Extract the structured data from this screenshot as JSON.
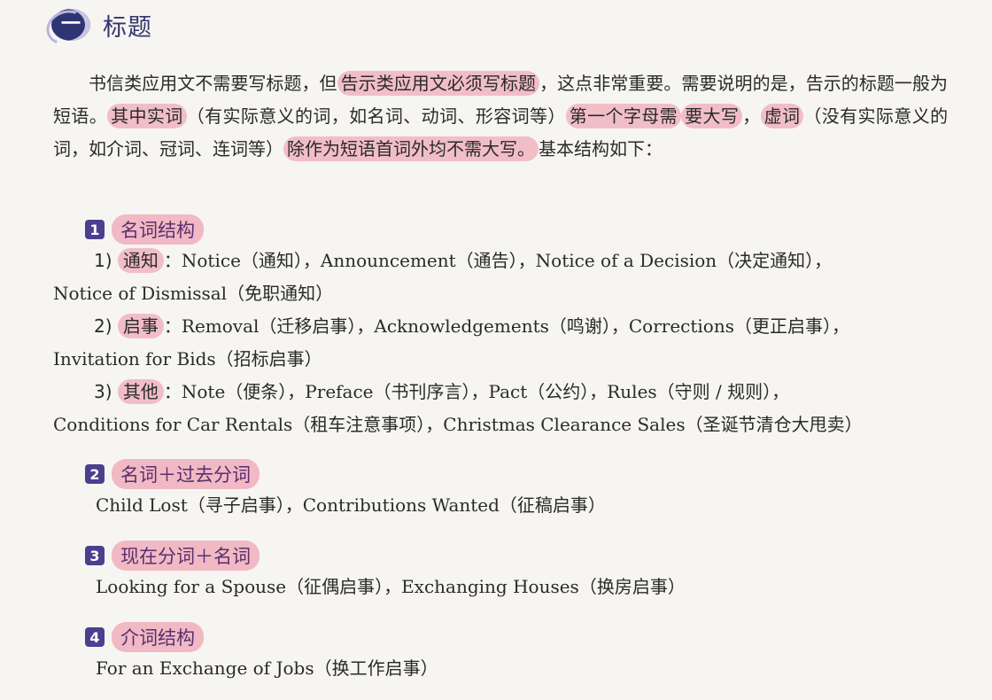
{
  "header": {
    "badge": "一",
    "title": "标题"
  },
  "intro": {
    "line1_a": "书信类应用文不需要写标题，但",
    "line1_hl": "告示类应用文必须写标题",
    "line1_b": "，这点非常重要。需要说明的是，",
    "line2_a": "告示的标题一般为短语。",
    "line2_hl1": "其中实词",
    "line2_b": "（有实际意义的词，如名词、动词、形容词等）",
    "line2_hl2": "第一个字母需",
    "line3_hl2b": "要大写",
    "line3_a": "，",
    "line3_hl3": "虚词",
    "line3_b": "（没有实际意义的词，如介词、冠词、连词等）",
    "line3_hl4": "除作为短语首词外均不需大写。",
    "line3_c": "基",
    "line4": "本结构如下："
  },
  "sections": [
    {
      "num": "1",
      "title": "名词结构",
      "items": [
        {
          "prefix": "1)",
          "label": "通知",
          "colon": "：",
          "line1": "Notice（通知），Announcement（通告），Notice of a Decision（决定通知），",
          "line2": "Notice of Dismissal（免职通知）"
        },
        {
          "prefix": "2)",
          "label": "启事",
          "colon": "：",
          "line1": "Removal（迁移启事），Acknowledgements（鸣谢），Corrections（更正启事），",
          "line2": "Invitation for Bids（招标启事）"
        },
        {
          "prefix": "3)",
          "label": "其他",
          "colon": "：",
          "line1": "Note（便条），Preface（书刊序言），Pact（公约），Rules（守则 / 规则），",
          "line2": "Conditions for Car Rentals（租车注意事项），Christmas Clearance Sales（圣诞节清仓大甩卖）"
        }
      ]
    },
    {
      "num": "2",
      "title": "名词＋过去分词",
      "text": "Child Lost（寻子启事），Contributions Wanted（征稿启事）"
    },
    {
      "num": "3",
      "title": "现在分词＋名词",
      "text": "Looking for a Spouse（征偶启事），Exchanging Houses（换房启事）"
    },
    {
      "num": "4",
      "title": "介词结构",
      "text": "For an Exchange of Jobs（换工作启事）"
    }
  ]
}
